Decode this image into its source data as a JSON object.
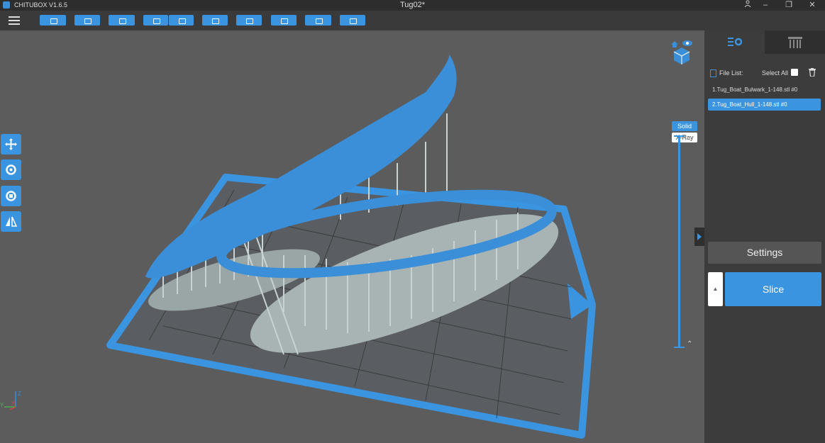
{
  "titlebar": {
    "app_name": "CHITUBOX V1.6.5",
    "doc_title": "Tug02*",
    "user_icon": "user-icon",
    "minimize": "–",
    "restore": "❐",
    "close": "✕"
  },
  "toolbar": {
    "menu_icon": "hamburger-menu-icon",
    "tools": [
      "open-file-icon",
      "save-icon",
      "import-icon",
      "undo-icon",
      "redo-icon",
      "layout-icon",
      "network-icon",
      "support-icon",
      "slice-view-icon",
      "add-print-icon"
    ]
  },
  "viewport": {
    "view_mode": {
      "solid": "Solid",
      "xray": "X-Ray"
    },
    "side_tools": [
      "move-icon",
      "rotate-icon",
      "scale-icon",
      "mirror-icon"
    ],
    "axes": {
      "x": "X",
      "y": "Y",
      "z": "Z"
    },
    "colors": {
      "model": "#3a8fd8",
      "support": "#a8b4b4",
      "plate": "#3a94e0",
      "background": "#5c5c5c"
    }
  },
  "panel": {
    "tabs": [
      "settings-tab-icon",
      "supports-tab-icon"
    ],
    "file_list_label": "File List:",
    "select_all_label": "Select All",
    "files": [
      {
        "name": "1.Tug_Boat_Bulwark_1-148.stl #0",
        "selected": false
      },
      {
        "name": "2.Tug_Boat_Hull_1-148.stl #0",
        "selected": true
      }
    ],
    "settings_label": "Settings",
    "slice_label": "Slice",
    "slice_side_label": "▲"
  }
}
